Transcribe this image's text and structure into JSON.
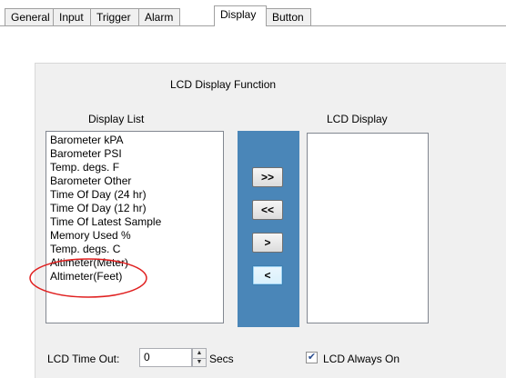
{
  "tabs": [
    {
      "label": "General"
    },
    {
      "label": "Input"
    },
    {
      "label": "Trigger"
    },
    {
      "label": "Alarm"
    },
    {
      "label": "Display"
    },
    {
      "label": "Button"
    }
  ],
  "active_tab": "Display",
  "section_title": "LCD Display Function",
  "display_list": {
    "label": "Display List",
    "items": [
      "Barometer kPA",
      "Barometer PSI",
      "Temp. degs. F",
      "Barometer Other",
      "Time Of Day (24 hr)",
      "Time Of Day (12 hr)",
      "Time Of Latest Sample",
      "Memory Used %",
      "Temp. degs. C",
      "Altimeter(Meter)",
      "Altimeter(Feet)"
    ]
  },
  "lcd_display": {
    "label": "LCD Display",
    "items": []
  },
  "move_buttons": {
    "add_all": ">>",
    "remove_all": "<<",
    "add_one": ">",
    "remove_one": "<"
  },
  "timeout": {
    "label": "LCD Time Out:",
    "value": "0",
    "unit": "Secs"
  },
  "always_on": {
    "label": "LCD Always On",
    "checked": true
  },
  "colors": {
    "highlight_ellipse": "#e02020",
    "mover_panel": "#4a86b8"
  }
}
